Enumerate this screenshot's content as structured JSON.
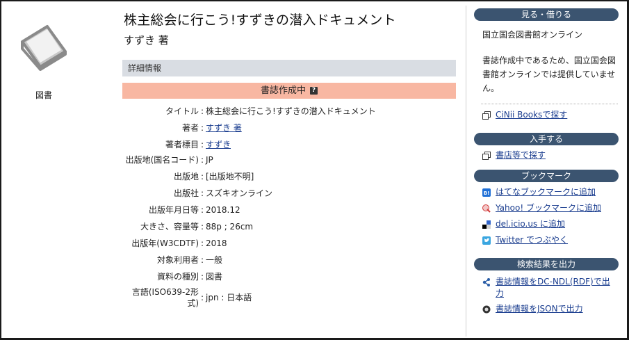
{
  "record": {
    "type_label": "図書",
    "title": "株主総会に行こう!すずきの潜入ドキュメント",
    "author_line": "すずき 著",
    "section_heading": "詳細情報",
    "status": "書誌作成中",
    "status_help": "?"
  },
  "details": [
    {
      "label": "タイトル",
      "value": "株主総会に行こう!すずきの潜入ドキュメント",
      "link": false
    },
    {
      "label": "著者",
      "value": "すずき 著",
      "link": true
    },
    {
      "label": "著者標目",
      "value": "すずき",
      "link": true
    },
    {
      "label": "出版地(国名コード)",
      "value": "JP",
      "link": false
    },
    {
      "label": "出版地",
      "value": "[出版地不明]",
      "link": false
    },
    {
      "label": "出版社",
      "value": "スズキオンライン",
      "link": false
    },
    {
      "label": "出版年月日等",
      "value": "2018.12",
      "link": false
    },
    {
      "label": "大きさ、容量等",
      "value": "88p ; 26cm",
      "link": false
    },
    {
      "label": "出版年(W3CDTF)",
      "value": "2018",
      "link": false
    },
    {
      "label": "対象利用者",
      "value": "一般",
      "link": false
    },
    {
      "label": "資料の種別",
      "value": "図書",
      "link": false
    },
    {
      "label": "言語(ISO639-2形式)",
      "value": "jpn : 日本語",
      "link": false
    }
  ],
  "sidebar": {
    "view": {
      "heading": "見る・借りる",
      "library": "国立国会図書館オンライン",
      "note": "書誌作成中であるため、国立国会図書館オンラインでは提供していません。",
      "cinii_link": "CiNii Booksで探す"
    },
    "obtain": {
      "heading": "入手する",
      "bookstore_link": "書店等で探す"
    },
    "bookmark": {
      "heading": "ブックマーク",
      "items": [
        "はてなブックマークに追加",
        "Yahoo! ブックマークに追加",
        "del.icio.us に追加",
        "Twitter でつぶやく"
      ]
    },
    "export": {
      "heading": "検索結果を出力",
      "items": [
        "書誌情報をDC-NDL(RDF)で出力",
        "書誌情報をJSONで出力"
      ]
    }
  }
}
